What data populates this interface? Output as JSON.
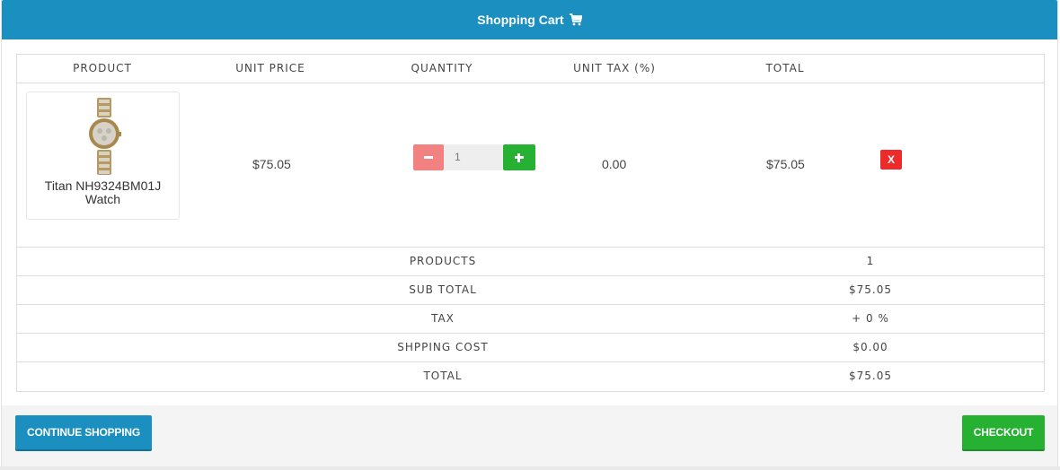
{
  "header": {
    "title": "Shopping Cart",
    "icon": "shopping-cart-icon"
  },
  "table": {
    "columns": [
      "PRODUCT",
      "UNIT PRICE",
      "QUANTITY",
      "UNIT TAX (%)",
      "TOTAL"
    ],
    "items": [
      {
        "name": "Titan NH9324BM01J Watch",
        "unit_price": "$75.05",
        "quantity": "1",
        "unit_tax": "0.00",
        "total": "$75.05",
        "remove_label": "X"
      }
    ]
  },
  "summary": [
    {
      "label": "PRODUCTS",
      "value": "1"
    },
    {
      "label": "SUB TOTAL",
      "value": "$75.05"
    },
    {
      "label": "TAX",
      "value": "+ 0 %"
    },
    {
      "label": "SHPPING COST",
      "value": "$0.00"
    },
    {
      "label": "TOTAL",
      "value": "$75.05"
    }
  ],
  "footer": {
    "continue_label": "CONTINUE SHOPPING",
    "checkout_label": "CHECKOUT"
  },
  "colors": {
    "header": "#1a8fc0",
    "continue_button": "#1a8fc0",
    "checkout_button": "#27b132",
    "plus_button": "#27b132",
    "minus_button": "#f28182",
    "remove_button": "#ee2b2b"
  }
}
